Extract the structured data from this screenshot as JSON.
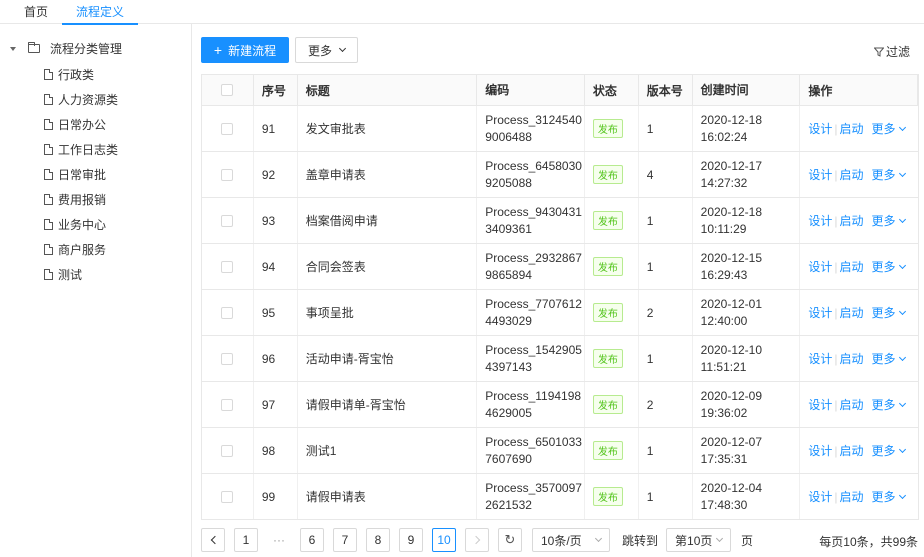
{
  "topnav": {
    "tabs": [
      "首页",
      "流程定义"
    ],
    "active": "流程定义"
  },
  "sidebar": {
    "root": "流程分类管理",
    "items": [
      "行政类",
      "人力资源类",
      "日常办公",
      "工作日志类",
      "日常审批",
      "费用报销",
      "业务中心",
      "商户服务",
      "测试"
    ]
  },
  "toolbar": {
    "new_label": "新建流程",
    "new_plus": "+",
    "more_label": "更多",
    "filter_label": "过滤"
  },
  "table": {
    "headers": [
      "序号",
      "标题",
      "编码",
      "状态",
      "版本号",
      "创建时间",
      "操作"
    ],
    "rows": [
      {
        "seq": "91",
        "title": "发文审批表",
        "code1": "Process_3124540",
        "code2": "9006488",
        "status": "发布",
        "ver": "1",
        "date": "2020-12-18",
        "time": "16:02:24"
      },
      {
        "seq": "92",
        "title": "盖章申请表",
        "code1": "Process_6458030",
        "code2": "9205088",
        "status": "发布",
        "ver": "4",
        "date": "2020-12-17",
        "time": "14:27:32"
      },
      {
        "seq": "93",
        "title": "档案借阅申请",
        "code1": "Process_9430431",
        "code2": "3409361",
        "status": "发布",
        "ver": "1",
        "date": "2020-12-18",
        "time": "10:11:29"
      },
      {
        "seq": "94",
        "title": "合同会签表",
        "code1": "Process_2932867",
        "code2": "9865894",
        "status": "发布",
        "ver": "1",
        "date": "2020-12-15",
        "time": "16:29:43"
      },
      {
        "seq": "95",
        "title": "事项呈批",
        "code1": "Process_7707612",
        "code2": "4493029",
        "status": "发布",
        "ver": "2",
        "date": "2020-12-01",
        "time": "12:40:00"
      },
      {
        "seq": "96",
        "title": "活动申请-胥宝怡",
        "code1": "Process_1542905",
        "code2": "4397143",
        "status": "发布",
        "ver": "1",
        "date": "2020-12-10",
        "time": "11:51:21"
      },
      {
        "seq": "97",
        "title": "请假申请单-胥宝怡",
        "code1": "Process_1194198",
        "code2": "4629005",
        "status": "发布",
        "ver": "2",
        "date": "2020-12-09",
        "time": "19:36:02"
      },
      {
        "seq": "98",
        "title": "测试1",
        "code1": "Process_6501033",
        "code2": "7607690",
        "status": "发布",
        "ver": "1",
        "date": "2020-12-07",
        "time": "17:35:31"
      },
      {
        "seq": "99",
        "title": "请假申请表",
        "code1": "Process_3570097",
        "code2": "2621532",
        "status": "发布",
        "ver": "1",
        "date": "2020-12-04",
        "time": "17:48:30"
      }
    ],
    "ops": {
      "design": "设计",
      "start": "启动",
      "more": "更多",
      "sep": "|"
    }
  },
  "pager": {
    "pages": [
      "1",
      "6",
      "7",
      "8",
      "9",
      "10"
    ],
    "current": "10",
    "ellipsis": "···",
    "page_size": "10条/页",
    "jump_label": "跳转到",
    "jump_value": "第10页",
    "page_unit": "页",
    "total": "每页10条，共99条"
  },
  "colors": {
    "primary": "#1890ff",
    "success": "#52c41a"
  }
}
